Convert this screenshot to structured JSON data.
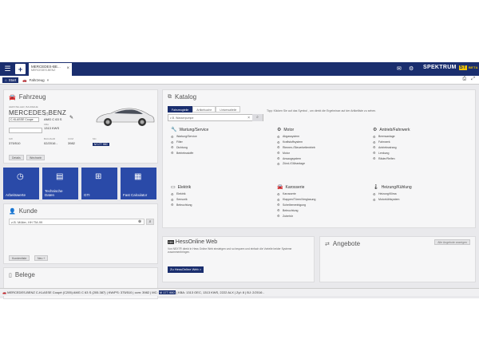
{
  "topbar": {
    "tab_title": "MERCEDES-BE...",
    "tab_subtitle": "MERCEDES-BENZ",
    "brand_name": "SPEKTRUM",
    "brand_badge": "ST",
    "brand_beta": "BETA",
    "menu_icon": "hamburger-icon",
    "add_icon": "plus-icon"
  },
  "subbar": {
    "start_label": "Start",
    "crumb_label": "Fahrzeug"
  },
  "fahrzeug": {
    "title": "Fahrzeug",
    "label_hersteller": "HERSTELLER, BAUREIHE",
    "brand": "MERCEDES-BENZ",
    "model": "C-KLASSE Coupe",
    "label_typ": "TYP",
    "typ": "AMG C 63 S",
    "label_kba": "KBA",
    "kba": "1313 KWS",
    "label_kw": "KW",
    "kw": "375/510",
    "label_ccm": "CCM",
    "ccm": "3982",
    "label_baujahr": "BAUJAHR",
    "baujahr": "02/2016 -",
    "label_mc": "MC",
    "mc": "M 177 980",
    "btn_details": "Details",
    "btn_wechseln": "Wechseln"
  },
  "tiles": [
    {
      "label": "Arbeitswerte",
      "icon": "clock-icon"
    },
    {
      "label": "Technische Daten",
      "icon": "document-icon"
    },
    {
      "label": "GTI",
      "icon": "network-icon"
    },
    {
      "label": "Fast Calculator",
      "icon": "calculator-icon"
    }
  ],
  "kunde": {
    "title": "Kunde",
    "search_placeholder": "z.B. Müller, HH TM-99",
    "btn_kundenliste": "Kundenliste",
    "btn_neu": "Neu +"
  },
  "belege": {
    "title": "Belege"
  },
  "katalog": {
    "title": "Katalog",
    "tabs": [
      "Fahrzeugteile",
      "Artikelsuche",
      "Universalteile"
    ],
    "search_placeholder": "z.B. Wasserpumpe",
    "tip": "Tipp: Klicken Sie auf das Symbol  , um direkt die Ergebnisse auf der Artikelliste zu sehen.",
    "groups": {
      "wartung": {
        "title": "Wartung/Service",
        "items": [
          "Wartung/Service",
          "Filter",
          "Dichtung",
          "Betriebsstoffe"
        ]
      },
      "motor": {
        "title": "Motor",
        "items": [
          "Abgassystem",
          "Kraftstoffsystem",
          "Riemen-/Steuerkettentrieb",
          "Motor",
          "Ansaugsystem",
          "Zünd-/Glühanlage"
        ]
      },
      "antrieb": {
        "title": "Antrieb/Fahrwerk",
        "items": [
          "Bremsanlage",
          "Fahrwerk",
          "Antriebsstrang",
          "Lenkung",
          "Räder/Reifen"
        ]
      },
      "elektrik": {
        "title": "Elektrik",
        "items": [
          "Elektrik",
          "Sensorik",
          "Beleuchtung"
        ]
      },
      "karosserie": {
        "title": "Karosserie",
        "items": [
          "Karosserie",
          "Klappen/Türen/Verglasung",
          "Scheibenreinigung",
          "Beleuchtung",
          "Zubehör"
        ]
      },
      "heizung": {
        "title": "Heizung/Kühlung",
        "items": [
          "Heizung/Klima",
          "Motorkühlsystem"
        ]
      }
    }
  },
  "hess": {
    "logo": "HH",
    "title": "HessOnline Web",
    "desc": "Von NEXT® direkt in Hess Online Web einsteigen und so bequem und einfach die Vorteile beider Systeme zusammenbringen.",
    "btn": "Zu HessOnline Web >"
  },
  "angebote": {
    "title": "Angebote",
    "btn": "Alle Angebote anzeigen"
  },
  "status": {
    "prefix": "MERCEDES-BENZ C-KLASSE Coupé (C205) AMG C 63 S (205.387) | KW/PS: 375/510 | ccm: 3982 | MC:",
    "mc": "M 177.980",
    "suffix": "| KBA: 1313 OEC, 1313 KWS, 2222 ALX | ZyI: 8 | BJ: 2/2016 -"
  }
}
